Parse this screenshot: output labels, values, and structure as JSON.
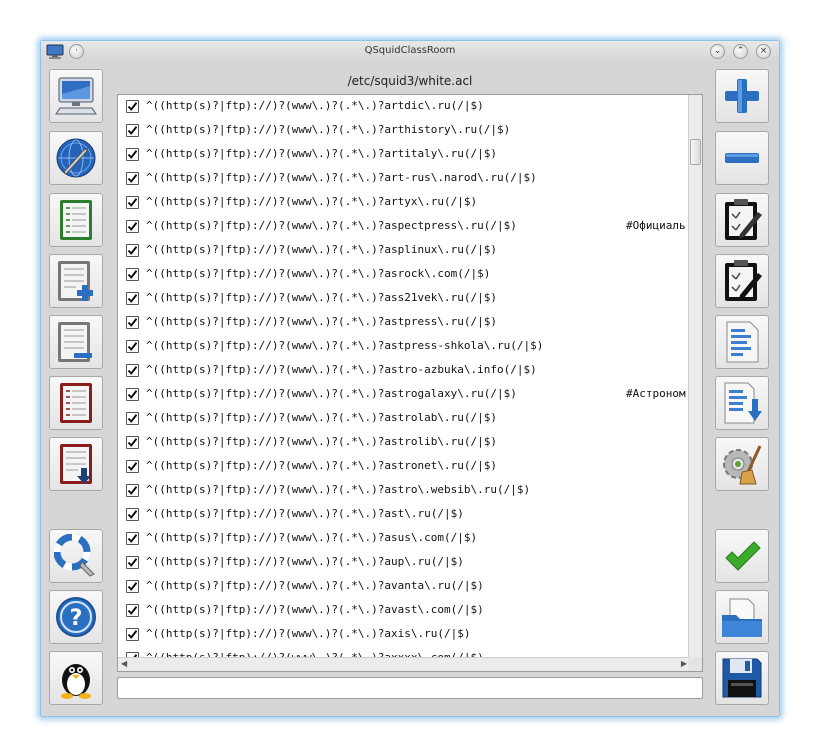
{
  "window": {
    "title": "QSquidClassRoom"
  },
  "path_label": "/etc/squid3/white.acl",
  "left_toolbar": [
    {
      "name": "network-computer-icon"
    },
    {
      "name": "globe-wrench-icon"
    },
    {
      "name": "green-list-icon"
    },
    {
      "name": "list-add-icon"
    },
    {
      "name": "list-edit-icon"
    },
    {
      "name": "red-list-icon"
    },
    {
      "name": "red-list-download-icon"
    },
    {
      "name": "lifebuoy-search-icon"
    },
    {
      "name": "help-icon"
    },
    {
      "name": "tux-penguin-icon"
    }
  ],
  "right_toolbar": [
    {
      "name": "add-icon"
    },
    {
      "name": "remove-icon"
    },
    {
      "name": "clipboard-edit-icon"
    },
    {
      "name": "clipboard-edit-dark-icon"
    },
    {
      "name": "document-lines-icon"
    },
    {
      "name": "document-download-icon"
    },
    {
      "name": "gear-broom-icon"
    },
    {
      "name": "apply-checkmark-icon"
    },
    {
      "name": "open-folder-icon"
    },
    {
      "name": "save-floppy-icon"
    }
  ],
  "entries": [
    {
      "checked": true,
      "text": "^((http(s)?|ftp)://)?(www\\.)?(.*\\.)?artdic\\.ru(/|$)",
      "comment": ""
    },
    {
      "checked": true,
      "text": "^((http(s)?|ftp)://)?(www\\.)?(.*\\.)?arthistory\\.ru(/|$)",
      "comment": ""
    },
    {
      "checked": true,
      "text": "^((http(s)?|ftp)://)?(www\\.)?(.*\\.)?artitaly\\.ru(/|$)",
      "comment": ""
    },
    {
      "checked": true,
      "text": "^((http(s)?|ftp)://)?(www\\.)?(.*\\.)?art-rus\\.narod\\.ru(/|$)",
      "comment": ""
    },
    {
      "checked": true,
      "text": "^((http(s)?|ftp)://)?(www\\.)?(.*\\.)?artyx\\.ru(/|$)",
      "comment": ""
    },
    {
      "checked": true,
      "text": "^((http(s)?|ftp)://)?(www\\.)?(.*\\.)?aspectpress\\.ru(/|$)",
      "comment": "#Официаль"
    },
    {
      "checked": true,
      "text": "^((http(s)?|ftp)://)?(www\\.)?(.*\\.)?asplinux\\.ru(/|$)",
      "comment": ""
    },
    {
      "checked": true,
      "text": "^((http(s)?|ftp)://)?(www\\.)?(.*\\.)?asrock\\.com(/|$)",
      "comment": ""
    },
    {
      "checked": true,
      "text": "^((http(s)?|ftp)://)?(www\\.)?(.*\\.)?ass21vek\\.ru(/|$)",
      "comment": ""
    },
    {
      "checked": true,
      "text": "^((http(s)?|ftp)://)?(www\\.)?(.*\\.)?astpress\\.ru(/|$)",
      "comment": ""
    },
    {
      "checked": true,
      "text": "^((http(s)?|ftp)://)?(www\\.)?(.*\\.)?astpress-shkola\\.ru(/|$)",
      "comment": ""
    },
    {
      "checked": true,
      "text": "^((http(s)?|ftp)://)?(www\\.)?(.*\\.)?astro-azbuka\\.info(/|$)",
      "comment": ""
    },
    {
      "checked": true,
      "text": "^((http(s)?|ftp)://)?(www\\.)?(.*\\.)?astrogalaxy\\.ru(/|$)",
      "comment": "#Астроном"
    },
    {
      "checked": true,
      "text": "^((http(s)?|ftp)://)?(www\\.)?(.*\\.)?astrolab\\.ru(/|$)",
      "comment": ""
    },
    {
      "checked": true,
      "text": "^((http(s)?|ftp)://)?(www\\.)?(.*\\.)?astrolib\\.ru(/|$)",
      "comment": ""
    },
    {
      "checked": true,
      "text": "^((http(s)?|ftp)://)?(www\\.)?(.*\\.)?astronet\\.ru(/|$)",
      "comment": ""
    },
    {
      "checked": true,
      "text": "^((http(s)?|ftp)://)?(www\\.)?(.*\\.)?astro\\.websib\\.ru(/|$)",
      "comment": ""
    },
    {
      "checked": true,
      "text": "^((http(s)?|ftp)://)?(www\\.)?(.*\\.)?ast\\.ru(/|$)",
      "comment": ""
    },
    {
      "checked": true,
      "text": "^((http(s)?|ftp)://)?(www\\.)?(.*\\.)?asus\\.com(/|$)",
      "comment": ""
    },
    {
      "checked": true,
      "text": "^((http(s)?|ftp)://)?(www\\.)?(.*\\.)?aup\\.ru(/|$)",
      "comment": ""
    },
    {
      "checked": true,
      "text": "^((http(s)?|ftp)://)?(www\\.)?(.*\\.)?avanta\\.ru(/|$)",
      "comment": ""
    },
    {
      "checked": true,
      "text": "^((http(s)?|ftp)://)?(www\\.)?(.*\\.)?avast\\.com(/|$)",
      "comment": ""
    },
    {
      "checked": true,
      "text": "^((http(s)?|ftp)://)?(www\\.)?(.*\\.)?axis\\.ru(/|$)",
      "comment": ""
    },
    {
      "checked": true,
      "text": "^((http(s)?|ftp)://)?(www\\.)?(.*\\.)?axxxx\\.com(/|$)",
      "comment": ""
    }
  ],
  "input": {
    "value": "",
    "placeholder": ""
  },
  "colors": {
    "accent_blue": "#2a6fc0",
    "check_green": "#3caa2a",
    "window_glow": "#8ec2e6"
  }
}
